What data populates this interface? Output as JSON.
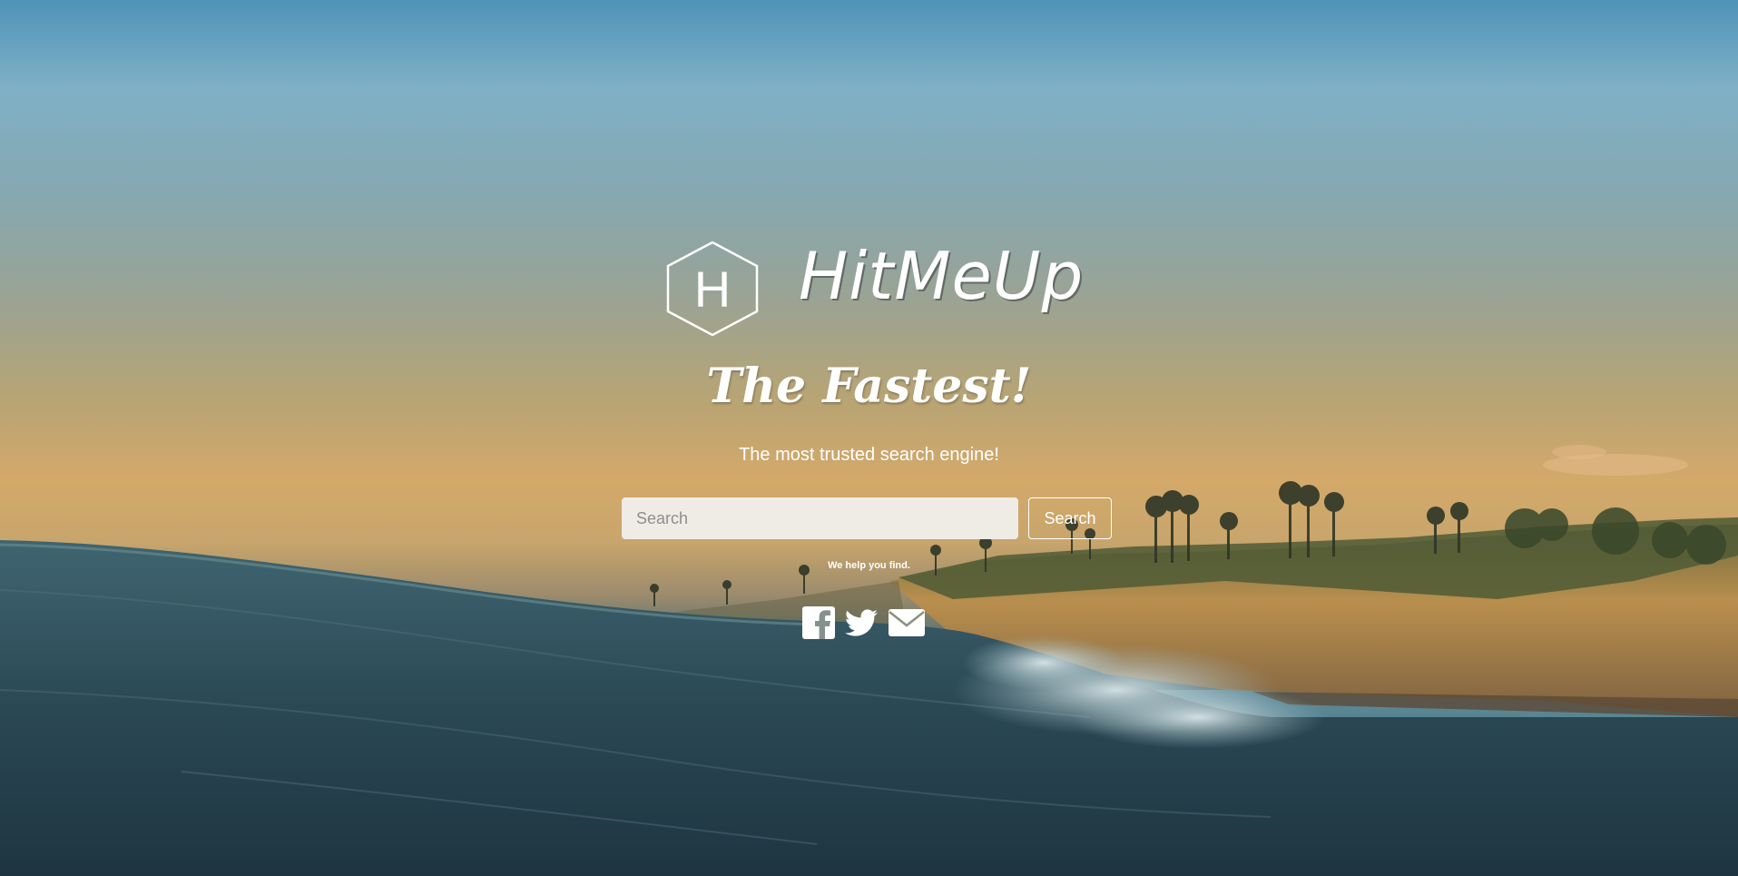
{
  "brand": {
    "name": "HitMeUp",
    "logo_letter": "H"
  },
  "hero": {
    "tagline": "The Fastest!",
    "subtitle": "The most trusted search engine!"
  },
  "search": {
    "placeholder": "Search",
    "button_label": "Search",
    "help_text": "We help you find."
  },
  "social": {
    "icons": [
      "facebook-icon",
      "twitter-icon",
      "envelope-icon"
    ]
  },
  "colors": {
    "text": "#ffffff",
    "input_bg": "#efece6"
  }
}
